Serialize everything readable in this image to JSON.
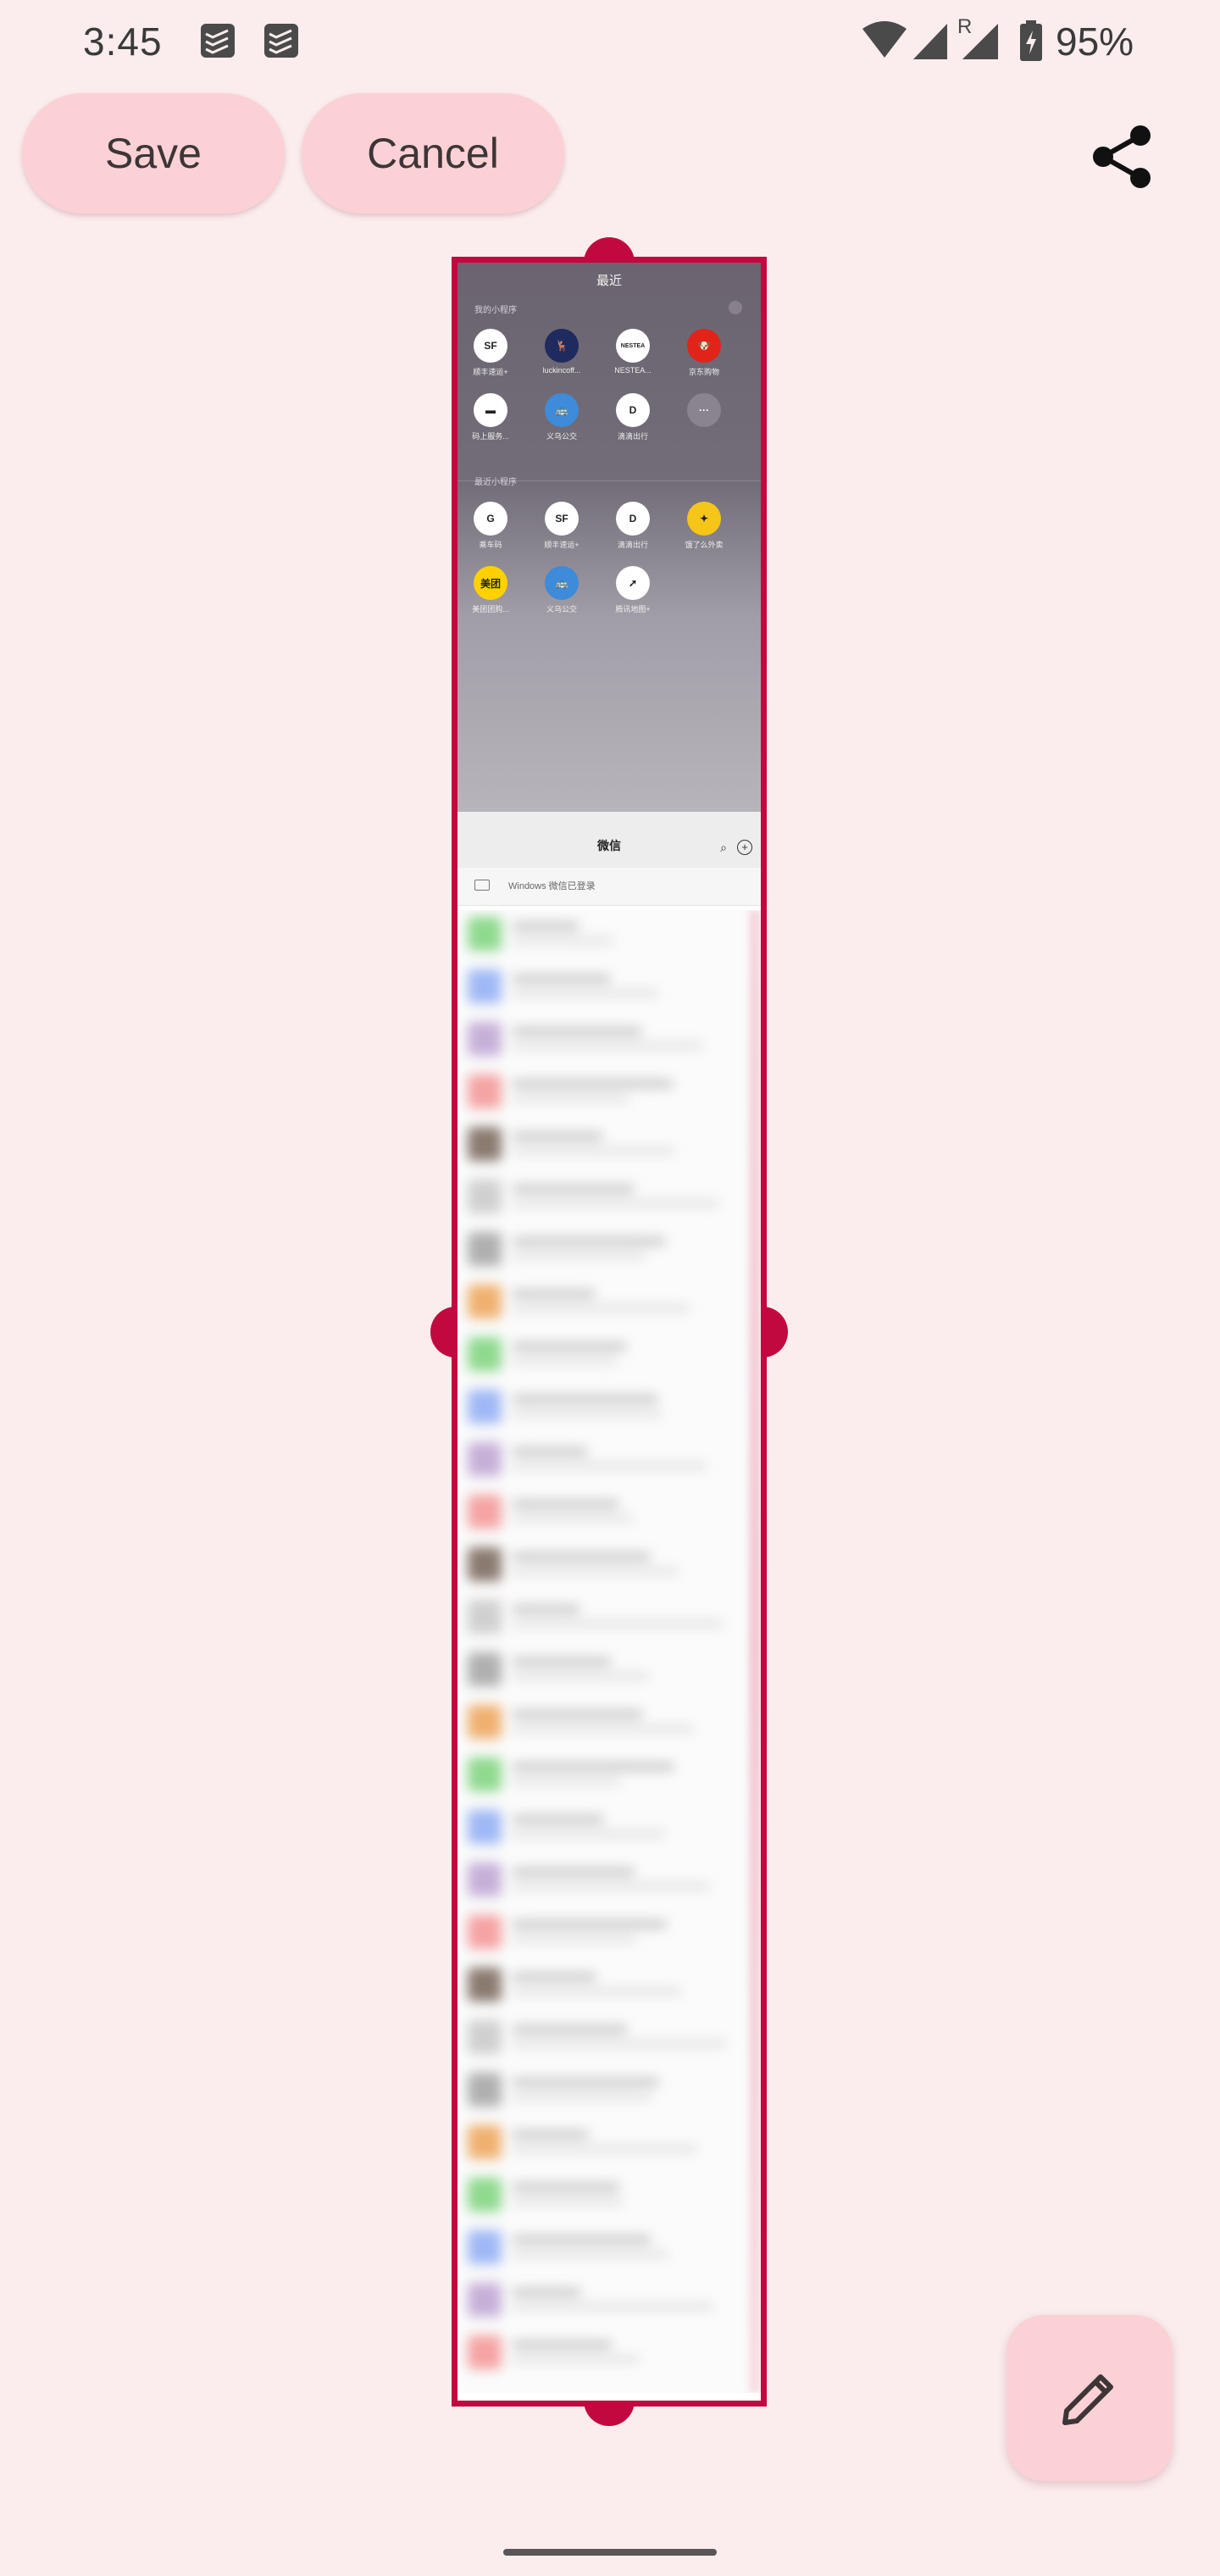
{
  "status_bar": {
    "time": "3:45",
    "battery": "95%",
    "roaming_indicator": "R",
    "icons": [
      "todoist-notification-icon",
      "todoist-notification-icon",
      "wifi-icon",
      "cell-signal-icon",
      "cell-signal-roaming-icon",
      "battery-charging-icon"
    ]
  },
  "toolbar": {
    "save_label": "Save",
    "cancel_label": "Cancel",
    "share_icon": "share-icon"
  },
  "preview": {
    "recent_title": "最近",
    "my_miniprograms_label": "我的小程序",
    "recent_miniprograms_label": "最近小程序",
    "my_apps": [
      {
        "label": "顺丰速运+",
        "icon_text": "SF",
        "color": "#ffffff"
      },
      {
        "label": "luckincoff...",
        "icon_text": "🦌",
        "color": "#1f2a5e"
      },
      {
        "label": "NESTEA...",
        "icon_text": "NESTEA",
        "color": "#ffffff"
      },
      {
        "label": "京东购物",
        "icon_text": "🐶",
        "color": "#e2231a"
      },
      {
        "label": "码上服务...",
        "icon_text": "▬",
        "color": "#ffffff"
      },
      {
        "label": "义乌公交",
        "icon_text": "🚌",
        "color": "#3d8bd9"
      },
      {
        "label": "滴滴出行",
        "icon_text": "D",
        "color": "#ffffff"
      },
      {
        "label": "",
        "icon_text": "···",
        "color": "#8a8490"
      }
    ],
    "recent_apps": [
      {
        "label": "乘车码",
        "icon_text": "G",
        "color": "#ffffff"
      },
      {
        "label": "顺丰速运+",
        "icon_text": "SF",
        "color": "#ffffff"
      },
      {
        "label": "滴滴出行",
        "icon_text": "D",
        "color": "#ffffff"
      },
      {
        "label": "饿了么外卖",
        "icon_text": "✦",
        "color": "#f5c518"
      },
      {
        "label": "美团团购...",
        "icon_text": "美团",
        "color": "#ffd100"
      },
      {
        "label": "义乌公交",
        "icon_text": "🚌",
        "color": "#3d8bd9"
      },
      {
        "label": "腾讯地图+",
        "icon_text": "➚",
        "color": "#ffffff"
      }
    ],
    "wechat_title": "微信",
    "windows_login_text": "Windows 微信已登录"
  },
  "fab": {
    "icon": "pencil-icon"
  },
  "colors": {
    "background": "#fbeced",
    "accent": "#c2093f",
    "pill": "#fbd1d6"
  }
}
